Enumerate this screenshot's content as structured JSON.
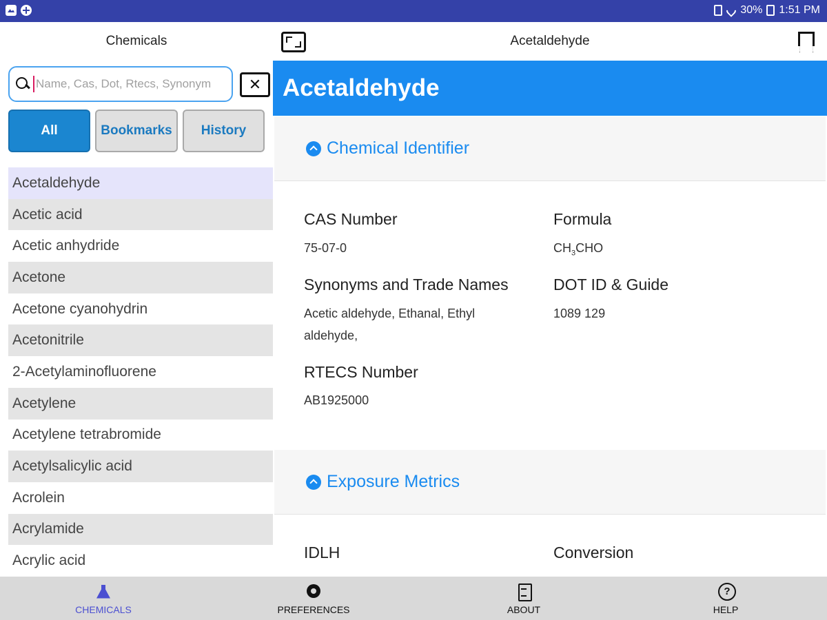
{
  "status_bar": {
    "battery": "30%",
    "time": "1:51 PM"
  },
  "left_pane": {
    "title": "Chemicals",
    "search_placeholder": "Name, Cas, Dot, Rtecs, Synonym",
    "clear_label": "✕",
    "filters": {
      "all": "All",
      "bookmarks": "Bookmarks",
      "history": "History"
    },
    "chemicals": [
      "Acetaldehyde",
      "Acetic acid",
      "Acetic anhydride",
      "Acetone",
      "Acetone cyanohydrin",
      "Acetonitrile",
      "2-Acetylaminofluorene",
      "Acetylene",
      "Acetylene tetrabromide",
      "Acetylsalicylic acid",
      "Acrolein",
      "Acrylamide",
      "Acrylic acid"
    ]
  },
  "right_pane": {
    "title": "Acetaldehyde",
    "banner": "Acetaldehyde",
    "sections": {
      "identifier": "Chemical Identifier",
      "exposure": "Exposure Metrics"
    },
    "fields": {
      "cas_label": "CAS Number",
      "cas_value": "75-07-0",
      "formula_label": "Formula",
      "formula_value_pre": "CH",
      "formula_value_sub": "3",
      "formula_value_post": "CHO",
      "synonyms_label": "Synonyms and Trade Names",
      "synonyms_value": "Acetic aldehyde, Ethanal, Ethyl aldehyde,",
      "dot_label": "DOT ID & Guide",
      "dot_value": "1089 129",
      "rtecs_label": "RTECS Number",
      "rtecs_value": "AB1925000",
      "idlh_label": "IDLH",
      "conversion_label": "Conversion"
    }
  },
  "bottom_nav": {
    "chemicals": "CHEMICALS",
    "preferences": "PREFERENCES",
    "about": "ABOUT",
    "help": "HELP"
  }
}
